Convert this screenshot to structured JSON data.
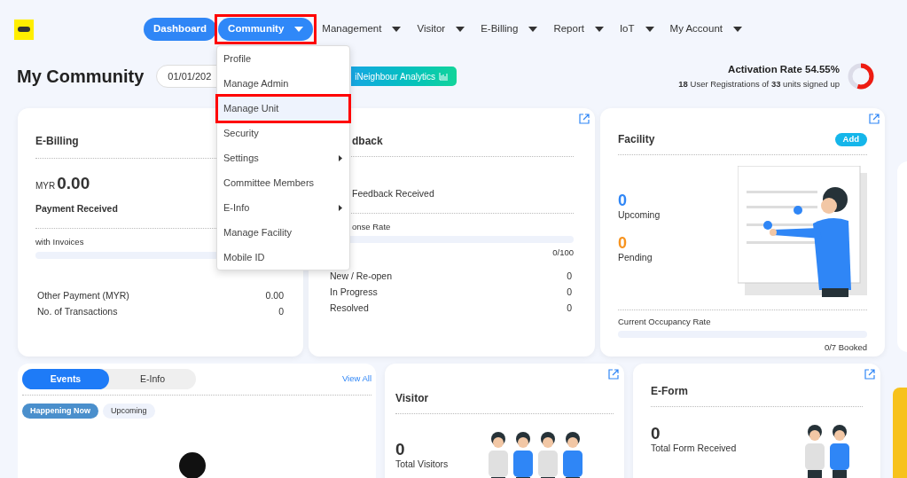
{
  "nav": [
    {
      "label": "Dashboard",
      "kind": "link",
      "selected": true,
      "expanded": false,
      "highlighted": false
    },
    {
      "label": "Community",
      "kind": "menu",
      "selected": false,
      "expanded": true,
      "highlighted": true
    },
    {
      "label": "Management",
      "kind": "menu",
      "selected": false,
      "expanded": false,
      "highlighted": false
    },
    {
      "label": "Visitor",
      "kind": "menu",
      "selected": false,
      "expanded": false,
      "highlighted": false
    },
    {
      "label": "E-Billing",
      "kind": "menu",
      "selected": false,
      "expanded": false,
      "highlighted": false
    },
    {
      "label": "Report",
      "kind": "menu",
      "selected": false,
      "expanded": false,
      "highlighted": false
    },
    {
      "label": "IoT",
      "kind": "menu",
      "selected": false,
      "expanded": false,
      "highlighted": false
    },
    {
      "label": "My Account",
      "kind": "menu",
      "selected": false,
      "expanded": false,
      "highlighted": false
    }
  ],
  "dropdown": [
    {
      "label": "Profile",
      "submenu": false,
      "selected": false,
      "highlighted": false
    },
    {
      "label": "Manage Admin",
      "submenu": false,
      "selected": false,
      "highlighted": false
    },
    {
      "label": "Manage Unit",
      "submenu": false,
      "selected": true,
      "highlighted": true
    },
    {
      "label": "Security",
      "submenu": false,
      "selected": false,
      "highlighted": false
    },
    {
      "label": "Settings",
      "submenu": true,
      "selected": false,
      "highlighted": false
    },
    {
      "label": "Committee Members",
      "submenu": false,
      "selected": false,
      "highlighted": false
    },
    {
      "label": "E-Info",
      "submenu": true,
      "selected": false,
      "highlighted": false
    },
    {
      "label": "Manage Facility",
      "submenu": false,
      "selected": false,
      "highlighted": false
    },
    {
      "label": "Mobile ID",
      "submenu": false,
      "selected": false,
      "highlighted": false
    }
  ],
  "page_title": "My Community",
  "date_field": {
    "value": "01/01/202"
  },
  "analytics_button": "iNeighbour Analytics",
  "activation": {
    "title": "Activation Rate 54.55%",
    "text": "**18** User Registrations of **33** units signed up",
    "level": 0.5455
  },
  "ebilling": {
    "title": "E-Billing",
    "currency": "MYR",
    "amount": "0.00",
    "amount_label": "Payment Received",
    "bar_label": "with Invoices",
    "level": 0,
    "rows": [
      {
        "label": "Other Payment (MYR)",
        "value": "0.00"
      },
      {
        "label": "No. of Transactions",
        "value": "0"
      }
    ]
  },
  "feedback": {
    "title": "dback",
    "received_label": "Feedback Received",
    "rate_label": "onse Rate",
    "level": 0,
    "rate": "0/100",
    "rows": [
      {
        "label": "New / Re-open",
        "value": "0"
      },
      {
        "label": "In Progress",
        "value": "0"
      },
      {
        "label": "Resolved",
        "value": "0"
      }
    ]
  },
  "facility": {
    "title": "Facility",
    "add": "Add",
    "stats": [
      {
        "value": "0",
        "label": "Upcoming",
        "color": "#2f86f6"
      },
      {
        "value": "0",
        "label": "Pending",
        "color": "#f7931e"
      }
    ],
    "occupancy_label": "Current Occupancy Rate",
    "level": 0,
    "booked": "0/7 Booked"
  },
  "events": {
    "tabs": [
      {
        "label": "Events",
        "selected": true
      },
      {
        "label": "E-Info",
        "selected": false
      }
    ],
    "view_all": "View All",
    "chips": [
      {
        "label": "Happening Now",
        "selected": true
      },
      {
        "label": "Upcoming",
        "selected": false
      }
    ]
  },
  "visitor": {
    "title": "Visitor",
    "value": "0",
    "label": "Total Visitors"
  },
  "eform": {
    "title": "E-Form",
    "value": "0",
    "label": "Total Form Received"
  }
}
